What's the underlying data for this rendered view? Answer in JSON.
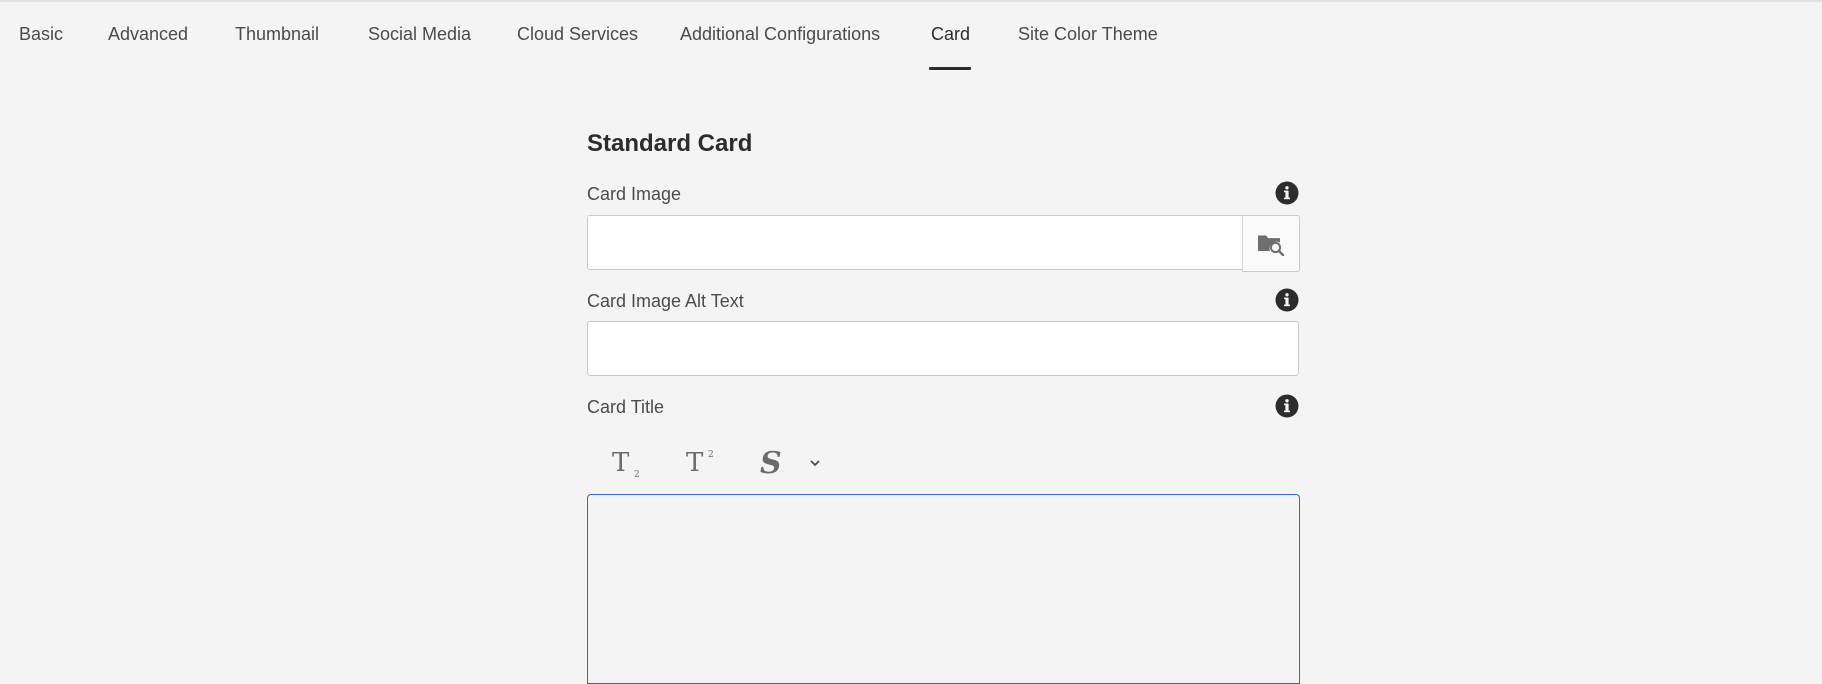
{
  "tabs": [
    {
      "label": "Basic"
    },
    {
      "label": "Advanced"
    },
    {
      "label": "Thumbnail"
    },
    {
      "label": "Social Media"
    },
    {
      "label": "Cloud Services"
    },
    {
      "label": "Additional Configurations"
    },
    {
      "label": "Card"
    },
    {
      "label": "Site Color Theme"
    }
  ],
  "active_tab": "Card",
  "form": {
    "section_title": "Standard Card",
    "card_image": {
      "label": "Card Image",
      "value": "",
      "placeholder": ""
    },
    "card_image_alt": {
      "label": "Card Image Alt Text",
      "value": "",
      "placeholder": ""
    },
    "card_title": {
      "label": "Card Title",
      "toolbar": [
        {
          "icon": "subscript-icon"
        },
        {
          "icon": "superscript-icon"
        },
        {
          "icon": "strikethrough-icon"
        },
        {
          "icon": "chevron-down-icon"
        }
      ],
      "value": ""
    }
  },
  "icons": {
    "info": "info-icon",
    "browse": "folder-search-icon"
  },
  "colors": {
    "background": "#f4f4f4",
    "focus_border": "#2b6ad4",
    "active_tab_underline": "#2c2c2c"
  }
}
